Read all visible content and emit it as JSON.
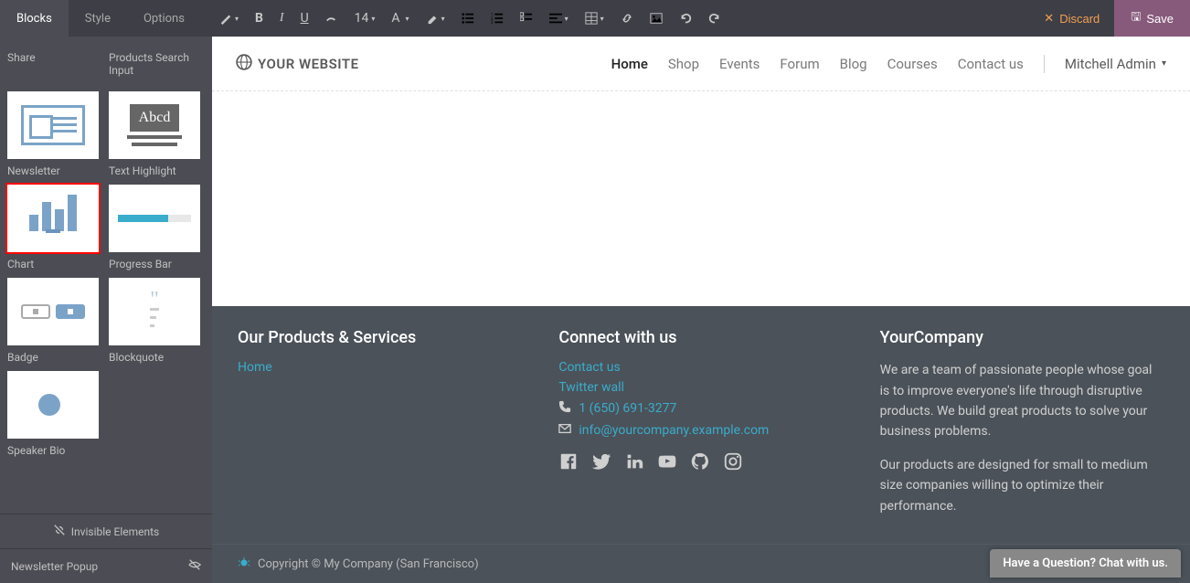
{
  "tabs": {
    "blocks": "Blocks",
    "style": "Style",
    "options": "Options"
  },
  "toolbar": {
    "font_size": "14",
    "discard": "Discard",
    "save": "Save"
  },
  "blocks": {
    "share": "Share",
    "search_input": "Products Search Input",
    "newsletter": "Newsletter",
    "text_highlight": "Text Highlight",
    "text_highlight_sample": "Abcd",
    "chart": "Chart",
    "progress_bar": "Progress Bar",
    "badge": "Badge",
    "blockquote": "Blockquote",
    "speaker_bio": "Speaker Bio"
  },
  "sidebar_footer": {
    "invisible": "Invisible Elements",
    "newsletter_popup": "Newsletter Popup"
  },
  "site": {
    "logo": "YOUR WEBSITE",
    "nav": {
      "home": "Home",
      "shop": "Shop",
      "events": "Events",
      "forum": "Forum",
      "blog": "Blog",
      "courses": "Courses",
      "contact": "Contact us"
    },
    "user": "Mitchell Admin"
  },
  "footer": {
    "col1_title": "Our Products & Services",
    "col1_link": "Home",
    "col2_title": "Connect with us",
    "contact_us": "Contact us",
    "twitter_wall": "Twitter wall",
    "phone": "1 (650) 691-3277",
    "email": "info@yourcompany.example.com",
    "col3_title": "YourCompany",
    "about1": "We are a team of passionate people whose goal is to improve everyone's life through disruptive products. We build great products to solve your business problems.",
    "about2": "Our products are designed for small to medium size companies willing to optimize their performance."
  },
  "copyright": "Copyright © My Company (San Francisco)",
  "chat": "Have a Question? Chat with us."
}
